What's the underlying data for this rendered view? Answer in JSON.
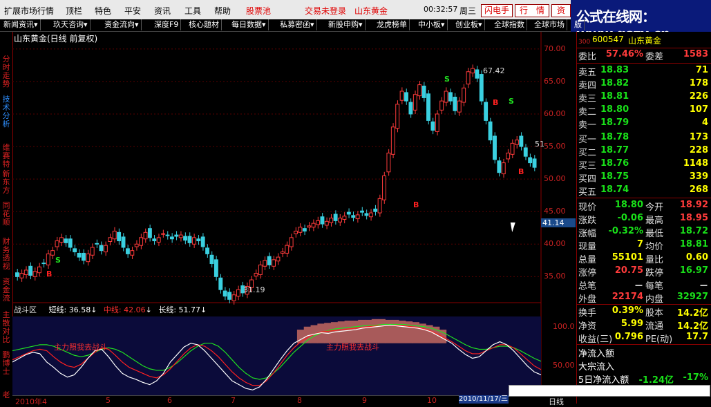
{
  "menu": {
    "items": [
      "扩展市场行情",
      "顶栏",
      "特色",
      "平安",
      "资讯",
      "工具",
      "帮助"
    ],
    "hot_item": "股票池",
    "notice": "交易未登录",
    "stock": "山东黄金",
    "clock": "00:32:57",
    "weekday": "周三",
    "btn_flash": "闪电手",
    "btn_quote": "行　情",
    "btn_info": "资"
  },
  "logo": {
    "text": "公式在线网：www.gszx.cn"
  },
  "tabs": [
    "新闻资讯▾",
    "玖天咨询▾",
    "资金流向▾",
    "深度F9",
    "核心题材",
    "每日数据▾",
    "私募密函▾",
    "新股申购▾",
    "龙虎榜单",
    "中小板▾",
    "创业板▾",
    "全球指数",
    "全球市场",
    "版"
  ],
  "leftnav": [
    {
      "label": "分时走势",
      "active": false
    },
    {
      "label": "技术分析",
      "active": true
    },
    {
      "label": "维赛特",
      "active": false
    },
    {
      "label": "新东方",
      "active": false
    },
    {
      "label": "同花顺",
      "active": false
    },
    {
      "label": "财务透视",
      "active": false
    },
    {
      "label": "资金流",
      "active": false
    },
    {
      "label": "主散对比",
      "active": false
    },
    {
      "label": "鹏博士",
      "active": false
    },
    {
      "label": "老",
      "active": false
    }
  ],
  "chart": {
    "title": "山东黄金(日线 前复权)",
    "high_label": "67.42",
    "low_label": "31.19",
    "right_label": "51",
    "price_tag": "41.14",
    "sub_title": "战斗区",
    "short_label": "短线: 36.58",
    "mid_label": "中线: 42.06",
    "long_label": "长线: 51.77",
    "annot1": "主力照我去战斗",
    "annot2": "主力照我去战斗",
    "date_label": "2010/11/17/三",
    "period": "日线",
    "colors": {
      "up": "#ff3b3b",
      "down": "#3ad0e0",
      "short": "#ffffff",
      "mid": "#ff2020",
      "long": "#20e020",
      "buy": "#ff2020",
      "sell": "#20e020"
    }
  },
  "chart_data": {
    "type": "candlestick",
    "title": "山东黄金(日线 前复权)",
    "price_axis": [
      "70.00",
      "65.00",
      "60.00",
      "55.00",
      "50.00",
      "45.00",
      "40.00",
      "35.00"
    ],
    "ylim": [
      31,
      72
    ],
    "indicator_axis": [
      "100.0",
      "50.00"
    ],
    "x_ticks": [
      "2010年4",
      "5",
      "6",
      "7",
      "8",
      "9",
      "10"
    ],
    "signals": [
      {
        "label": "S"
      },
      {
        "label": "B"
      }
    ],
    "closes": [
      35,
      35.5,
      36,
      35.2,
      35.8,
      36.5,
      37,
      38.5,
      39,
      40.5,
      41,
      40.2,
      39.5,
      38.8,
      38,
      37.5,
      38.5,
      39.5,
      40,
      39,
      39.8,
      41,
      42,
      40.5,
      39.5,
      38.5,
      39,
      40,
      41,
      41.8,
      41,
      40.5,
      41,
      41.6,
      41.3,
      40.8,
      41.2,
      41.4,
      40.6,
      40.2,
      41,
      40.5,
      39.6,
      38.5,
      37,
      35,
      33,
      32,
      31.5,
      32.2,
      33,
      32.5,
      33.5,
      34.5,
      35.5,
      36.8,
      37.5,
      36.8,
      37.6,
      38,
      38.8,
      39.8,
      41,
      42,
      42.6,
      42,
      42.8,
      43.2,
      43.6,
      43.1,
      43.5,
      44,
      43.6,
      44,
      44.3,
      44.6,
      44.1,
      44.5,
      44.9,
      44.4,
      44.8,
      45,
      47,
      50.5,
      54,
      58,
      61.5,
      63.5,
      62,
      60,
      63,
      64.5,
      62.5,
      59,
      57.5,
      60,
      62,
      63.5,
      62,
      60.5,
      62,
      64,
      66.5,
      67,
      65.5,
      62,
      59,
      56,
      53,
      51,
      52.5,
      54,
      55.5,
      56,
      55,
      53.5,
      52.5,
      51.8
    ],
    "short": [
      55,
      60,
      65,
      68,
      66,
      55,
      48,
      40,
      35,
      38,
      48,
      60,
      70,
      72,
      62,
      50,
      40,
      35,
      32,
      28,
      25,
      30,
      40,
      55,
      65,
      75,
      80,
      78,
      70,
      60,
      50,
      40,
      30,
      25,
      20,
      18,
      22,
      32,
      45,
      58,
      70,
      80,
      85,
      90,
      92,
      94,
      93,
      95,
      96,
      97,
      98,
      100,
      101,
      102,
      103,
      104,
      103,
      102,
      101,
      100,
      98,
      95,
      90,
      85,
      80,
      72,
      65,
      60,
      62,
      70,
      78,
      82,
      78,
      70,
      60,
      50,
      42,
      38
    ],
    "mid": [
      58,
      62,
      66,
      70,
      72,
      70,
      62,
      55,
      50,
      48,
      52,
      60,
      68,
      74,
      72,
      64,
      55,
      48,
      44,
      40,
      36,
      34,
      38,
      46,
      56,
      66,
      74,
      78,
      76,
      70,
      62,
      52,
      42,
      34,
      28,
      24,
      24,
      30,
      40,
      52,
      64,
      74,
      82,
      88,
      92,
      95,
      96,
      97,
      98,
      99,
      100,
      101,
      102,
      103,
      103,
      104,
      104,
      103,
      102,
      101,
      99,
      96,
      92,
      87,
      82,
      76,
      70,
      66,
      66,
      70,
      74,
      78,
      78,
      74,
      66,
      58,
      50,
      45
    ],
    "long": [
      70,
      72,
      74,
      76,
      78,
      78,
      76,
      72,
      68,
      64,
      62,
      64,
      68,
      72,
      74,
      72,
      68,
      62,
      56,
      50,
      46,
      44,
      44,
      48,
      54,
      62,
      70,
      76,
      80,
      80,
      76,
      68,
      58,
      48,
      40,
      34,
      32,
      34,
      40,
      48,
      58,
      68,
      76,
      84,
      90,
      94,
      97,
      99,
      100,
      101,
      102,
      103,
      104,
      104,
      105,
      105,
      105,
      105,
      104,
      103,
      102,
      100,
      97,
      93,
      88,
      83,
      78,
      74,
      72,
      72,
      74,
      76,
      76,
      74,
      70,
      65,
      60,
      56
    ],
    "mountain_values": [
      0,
      0,
      0,
      0,
      0,
      0,
      0,
      0,
      0,
      0,
      0,
      0,
      0,
      0,
      0,
      0,
      0,
      0,
      0,
      0,
      0,
      0,
      0,
      0,
      0,
      0,
      0,
      0,
      0,
      0,
      0,
      0,
      0,
      0,
      0,
      0,
      0,
      0,
      0,
      0,
      0,
      0,
      18,
      22,
      24,
      26,
      27,
      28,
      29,
      30,
      30,
      31,
      31,
      32,
      32,
      31,
      31,
      30,
      29,
      28,
      26,
      24,
      22,
      18,
      0,
      0,
      0,
      0,
      0,
      0,
      0,
      0,
      0,
      0,
      0,
      0,
      0,
      0
    ]
  },
  "quote": {
    "code_prefix": "300",
    "code": "600547",
    "name": "山东黄金",
    "weibi_label": "委比",
    "weibi": "57.46%",
    "weicha_label": "委差",
    "weicha": "1583",
    "asks": [
      {
        "label": "卖五",
        "price": "18.83",
        "vol": "71"
      },
      {
        "label": "卖四",
        "price": "18.82",
        "vol": "178"
      },
      {
        "label": "卖三",
        "price": "18.81",
        "vol": "226"
      },
      {
        "label": "卖二",
        "price": "18.80",
        "vol": "107"
      },
      {
        "label": "卖一",
        "price": "18.79",
        "vol": "4"
      }
    ],
    "bids": [
      {
        "label": "买一",
        "price": "18.78",
        "vol": "173"
      },
      {
        "label": "买二",
        "price": "18.77",
        "vol": "228"
      },
      {
        "label": "买三",
        "price": "18.76",
        "vol": "1148"
      },
      {
        "label": "买四",
        "price": "18.75",
        "vol": "339"
      },
      {
        "label": "买五",
        "price": "18.74",
        "vol": "268"
      }
    ],
    "stats": [
      {
        "l1": "现价",
        "v1": "18.80",
        "c1": "green",
        "l2": "今开",
        "v2": "18.92",
        "c2": "red"
      },
      {
        "l1": "涨跌",
        "v1": "-0.06",
        "c1": "green",
        "l2": "最高",
        "v2": "18.95",
        "c2": "red"
      },
      {
        "l1": "涨幅",
        "v1": "-0.32%",
        "c1": "green",
        "l2": "最低",
        "v2": "18.72",
        "c2": "green"
      },
      {
        "l1": "现量",
        "v1": "7",
        "c1": "yellow",
        "l2": "均价",
        "v2": "18.81",
        "c2": "green"
      },
      {
        "l1": "总量",
        "v1": "55101",
        "c1": "yellow",
        "l2": "量比",
        "v2": "0.60",
        "c2": "yellow"
      },
      {
        "l1": "涨停",
        "v1": "20.75",
        "c1": "red",
        "l2": "跌停",
        "v2": "16.97",
        "c2": "green"
      },
      {
        "l1": "总笔",
        "v1": "－",
        "c1": "white",
        "l2": "每笔",
        "v2": "－",
        "c2": "white"
      },
      {
        "l1": "外盘",
        "v1": "22174",
        "c1": "red",
        "l2": "内盘",
        "v2": "32927",
        "c2": "green"
      }
    ],
    "stats2": [
      {
        "l1": "换手",
        "v1": "0.39%",
        "c1": "yellow",
        "l2": "股本",
        "v2": "14.2亿",
        "c2": "yellow"
      },
      {
        "l1": "净资",
        "v1": "5.99",
        "c1": "yellow",
        "l2": "流通",
        "v2": "14.2亿",
        "c2": "yellow"
      },
      {
        "l1": "收益(三)",
        "v1": "0.796",
        "c1": "yellow",
        "l2": "PE(动)",
        "v2": "17.7",
        "c2": "yellow"
      }
    ],
    "flow1": "净流入额",
    "flow2": "大宗流入",
    "flow3_label": "5日净流入额",
    "flow3_v1": "-1.24亿",
    "flow3_v2": "-17%"
  }
}
